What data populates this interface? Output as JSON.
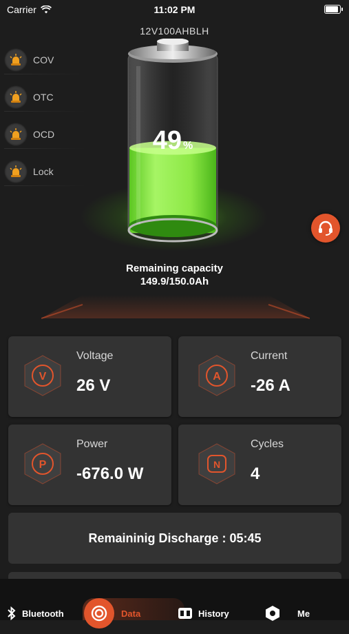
{
  "status_bar": {
    "carrier": "Carrier",
    "time": "11:02 PM"
  },
  "device": {
    "name": "12V100AHBLH"
  },
  "alarms": [
    {
      "label": "COV",
      "icon": "alarm-light-icon"
    },
    {
      "label": "OTC",
      "icon": "alarm-light-icon"
    },
    {
      "label": "OCD",
      "icon": "alarm-light-icon"
    },
    {
      "label": "Lock",
      "icon": "alarm-light-icon"
    }
  ],
  "battery": {
    "percent": "49",
    "unit": "%",
    "level": 0.49
  },
  "capacity": {
    "label": "Remaining capacity",
    "value": "149.9/150.0Ah"
  },
  "metrics": {
    "voltage": {
      "title": "Voltage",
      "value": "26 V",
      "icon_letter": "V"
    },
    "current": {
      "title": "Current",
      "value": "-26 A",
      "icon_letter": "A"
    },
    "power": {
      "title": "Power",
      "value": "-676.0 W",
      "icon_letter": "P"
    },
    "cycles": {
      "title": "Cycles",
      "value": "4",
      "icon_letter": "N"
    }
  },
  "discharge": {
    "text": "Remaininig Discharge : 05:45"
  },
  "tabs": [
    {
      "label": "Bluetooth",
      "icon": "bluetooth-icon"
    },
    {
      "label": "Data",
      "icon": "data-icon",
      "active": true
    },
    {
      "label": "History",
      "icon": "history-icon"
    },
    {
      "label": "Me",
      "icon": "me-icon"
    }
  ],
  "colors": {
    "accent": "#e2552c",
    "green": "#7ee83a",
    "card": "#333333",
    "background": "#1d1d1d"
  }
}
